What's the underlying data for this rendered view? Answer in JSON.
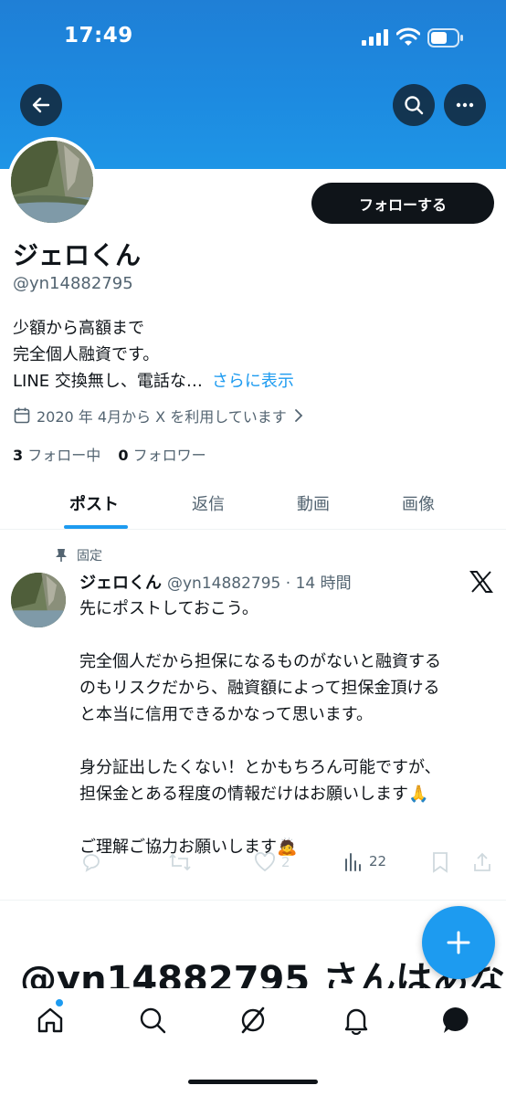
{
  "status_bar": {
    "time": "17:49"
  },
  "profile": {
    "name": "ジェロくん",
    "handle": "@yn14882795",
    "follow_label": "フォローする",
    "bio_lines": [
      "少額から高額まで",
      "完全個人融資です。",
      "LINE 交換無し、電話な…"
    ],
    "bio_more": "さらに表示",
    "joined": "2020 年 4月から X を利用しています",
    "following_count": "3",
    "following_label": "フォロー中",
    "followers_count": "0",
    "followers_label": "フォロワー"
  },
  "tabs": [
    {
      "label": "ポスト",
      "active": true
    },
    {
      "label": "返信",
      "active": false
    },
    {
      "label": "動画",
      "active": false
    },
    {
      "label": "画像",
      "active": false
    }
  ],
  "pinned_post": {
    "pinned_label": "固定",
    "author_name": "ジェロくん",
    "meta": "@yn14882795 · 14 時間",
    "lines": [
      "先にポストしておこう。",
      "",
      "完全個人だから担保になるものがないと融資する",
      "のもリスクだから、融資額によって担保金頂ける",
      "と本当に信用できるかなって思います。",
      "",
      "身分証出したくない！とかもちろん可能ですが、",
      "担保金とある程度の情報だけはお願いします🙏",
      "",
      "ご理解ご協力お願いします🙇"
    ],
    "likes": "2",
    "views": "22"
  },
  "next_section_heading": "@yn14882795 さんはあな",
  "icons": {
    "back": "arrow-left-icon",
    "search": "search-icon",
    "more": "more-horizontal-icon",
    "calendar": "calendar-icon",
    "chevron": "chevron-right-icon",
    "pin": "pin-icon",
    "reply": "reply-icon",
    "repost": "repost-icon",
    "like": "heart-icon",
    "views": "bar-chart-icon",
    "bookmark": "bookmark-icon",
    "share": "share-icon",
    "compose": "plus-icon",
    "home": "home-icon",
    "explore": "search-icon",
    "grok": "grok-icon",
    "notifications": "bell-icon",
    "messages": "message-icon"
  },
  "colors": {
    "accent": "#1d9bf0",
    "banner": "#1d8ae0",
    "text": "#0f1419",
    "muted": "#536471"
  }
}
